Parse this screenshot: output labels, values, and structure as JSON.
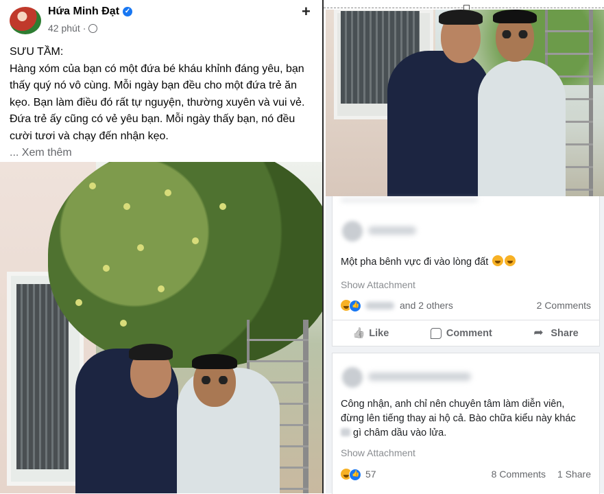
{
  "post": {
    "author": "Hứa Minh Đạt",
    "time": "42 phút",
    "separator": "·",
    "add_icon": "plus-icon",
    "body_heading": "SƯU TẦM:",
    "body_text": "Hàng xóm của bạn có một đứa bé kháu khỉnh đáng yêu, bạn thấy quý nó vô cùng. Mỗi ngày bạn đều cho một đứa trẻ ăn kẹo. Bạn làm điều đó rất tự nguyện, thường xuyên và vui vẻ. Đứa trẻ ấy cũng có vẻ yêu bạn. Mỗi ngày thấy bạn, nó đều cười tươi và chạy đến nhận kẹo.",
    "ellipsis": "...",
    "see_more": "Xem thêm"
  },
  "comments": [
    {
      "text": "Một pha bênh vực đi vào lòng đất",
      "show_attachment": "Show Attachment",
      "reactions_others": "and 2 others",
      "comments_count": "2 Comments",
      "actions": {
        "like": "Like",
        "comment": "Comment",
        "share": "Share"
      }
    },
    {
      "text_line1": "Công nhận, anh chỉ nên chuyên tâm làm diễn viên,",
      "text_line2": "đừng lên tiếng thay ai hộ cả. Bào chữa kiểu này khác",
      "text_line3": "gì châm dầu vào lửa.",
      "show_attachment": "Show Attachment",
      "reaction_count": "57",
      "comments_count": "8 Comments",
      "shares_count": "1 Share"
    }
  ],
  "colors": {
    "facebook_blue": "#1877f2",
    "haha_yellow": "#f7b125",
    "muted_text": "#65676b"
  }
}
